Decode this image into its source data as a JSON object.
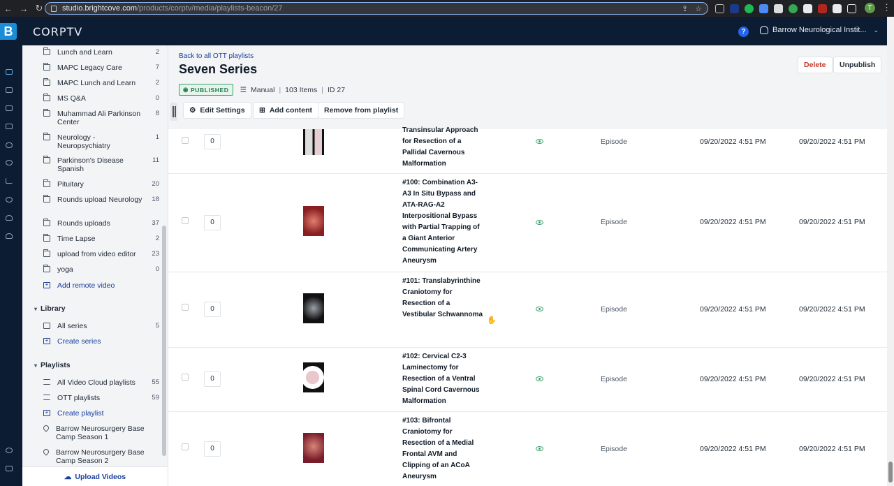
{
  "browser": {
    "url_host": "studio.brightcove.com",
    "url_path": "/products/corptv/media/playlists-beacon/27",
    "profile_initial": "T"
  },
  "app": {
    "brand": "CORPTV",
    "help_label": "?",
    "account": "Barrow Neurological Instit..."
  },
  "sidebar": {
    "folders": [
      {
        "label": "Lunch and Learn",
        "count": "2"
      },
      {
        "label": "MAPC Legacy Care",
        "count": "7"
      },
      {
        "label": "MAPC Lunch and Learn",
        "count": "2"
      },
      {
        "label": "MS Q&A",
        "count": "0"
      },
      {
        "label": "Muhammad Ali Parkinson Center",
        "count": "8"
      },
      {
        "label": "Neurology - Neuropsychiatry",
        "count": "1"
      },
      {
        "label": "Parkinson's Disease Spanish",
        "count": "11"
      },
      {
        "label": "Pituitary",
        "count": "20"
      },
      {
        "label": "Rounds upload Neurology",
        "count": "18"
      },
      {
        "label": "Rounds uploads",
        "count": "37"
      },
      {
        "label": "Time Lapse",
        "count": "2"
      },
      {
        "label": "upload from video editor",
        "count": "23"
      },
      {
        "label": "yoga",
        "count": "0"
      }
    ],
    "add_remote_video": "Add remote video",
    "library": {
      "heading": "Library",
      "all_series": "All series",
      "all_series_count": "5",
      "create_series": "Create series"
    },
    "playlists": {
      "heading": "Playlists",
      "all_video_cloud": "All Video Cloud playlists",
      "all_video_cloud_count": "55",
      "ott": "OTT playlists",
      "ott_count": "59",
      "create_playlist": "Create playlist",
      "pinned": [
        "Barrow Neurosurgery Base Camp Season 1",
        "Barrow Neurosurgery Base Camp Season 2"
      ]
    },
    "upload_videos": "Upload Videos"
  },
  "header": {
    "back_link": "Back to all OTT playlists",
    "title": "Seven Series",
    "status": "PUBLISHED",
    "mode": "Manual",
    "items": "103 Items",
    "id": "ID 27",
    "delete": "Delete",
    "unpublish": "Unpublish",
    "edit_settings": "Edit Settings",
    "add_content": "Add content",
    "remove_from_playlist": "Remove from playlist"
  },
  "rows": [
    {
      "position": "0",
      "name": "Transinsular Approach for Resection of a Pallidal Cavernous Malformation",
      "type": "Episode",
      "date1": "09/20/2022 4:51 PM",
      "date2": "09/20/2022 4:51 PM"
    },
    {
      "position": "0",
      "name": "#100: Combination A3-A3 In Situ Bypass and ATA-RAG-A2 Interpositional Bypass with Partial Trapping of a Giant Anterior Communicating Artery Aneurysm",
      "type": "Episode",
      "date1": "09/20/2022 4:51 PM",
      "date2": "09/20/2022 4:51 PM"
    },
    {
      "position": "0",
      "name": "#101: Translabyrinthine Craniotomy for Resection of a Vestibular Schwannoma",
      "type": "Episode",
      "date1": "09/20/2022 4:51 PM",
      "date2": "09/20/2022 4:51 PM"
    },
    {
      "position": "0",
      "name": "#102: Cervical C2-3 Laminectomy for Resection of a Ventral Spinal Cord Cavernous Malformation",
      "type": "Episode",
      "date1": "09/20/2022 4:51 PM",
      "date2": "09/20/2022 4:51 PM"
    },
    {
      "position": "0",
      "name": "#103: Bifrontal Craniotomy for Resection of a Medial Frontal AVM and Clipping of an ACoA Aneurysm",
      "type": "Episode",
      "date1": "09/20/2022 4:51 PM",
      "date2": "09/20/2022 4:51 PM"
    }
  ],
  "colors": {
    "brand_navy": "#0c1c33",
    "link": "#1a3e9c",
    "published": "#36a06a",
    "delete": "#c0392b"
  }
}
